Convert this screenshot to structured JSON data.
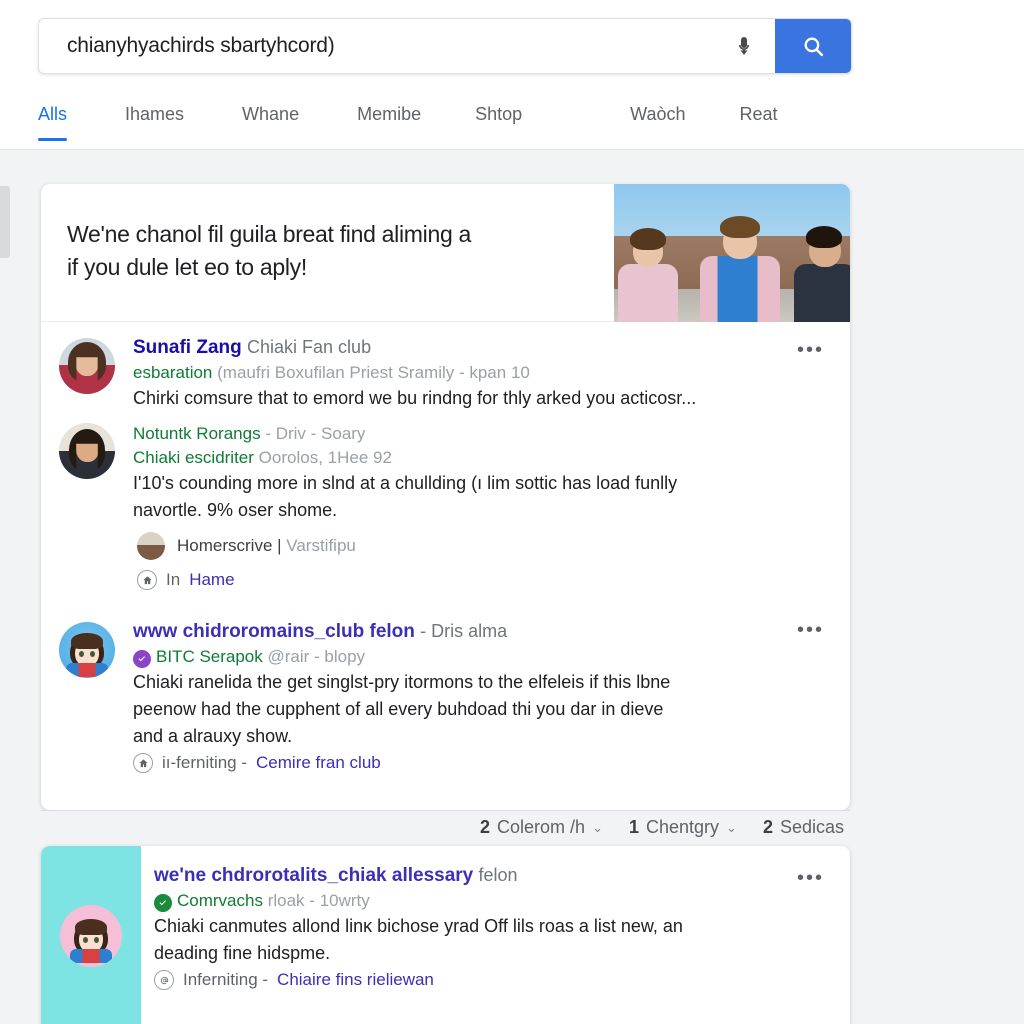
{
  "search": {
    "query": "chianyhyachirds sbartyhcord)",
    "placeholder": "Search",
    "mic_icon": "microphone-icon",
    "search_icon": "search-icon",
    "button_color": "#3a74e0"
  },
  "tabs": [
    {
      "label": "Alls",
      "active": true
    },
    {
      "label": "Ihames",
      "active": false
    },
    {
      "label": "Whane",
      "active": false
    },
    {
      "label": "Memibe",
      "active": false
    },
    {
      "label": "Shtop",
      "active": false
    },
    {
      "label": "Waòch",
      "active": false
    },
    {
      "label": "Reat",
      "active": false
    }
  ],
  "hero": {
    "line1": "We'ne chanol fil guila breat find aliming a",
    "line2": "if you dule let eo to aply!",
    "image_alt": "students-outdoors-photo"
  },
  "results": [
    {
      "title": "Sunafi Zang",
      "title_sub": "Chiaki Fan club",
      "meta_green": "esbaration",
      "meta_gray": "(maufri Boxufilan Priest Sramily - kpan 10",
      "snippet": "Chirki comsure that to emord we bu rindng for thly arked you acticosr...",
      "avatar": "photo-avatar-woman-red",
      "kebab": "•••"
    },
    {
      "meta_green": "Notuntk Rorangs",
      "meta_gray": "- Driv - Soary",
      "meta2_green": "Chiaki escidriter",
      "meta2_gray": "Oorolos, 1Hee 92",
      "snippet_line1": "I'10's counding more in slnd at a chullding (ı lim sottic has load funlly",
      "snippet_line2": "navortle. 9% oser shome.",
      "avatar": "photo-avatar-woman-dark"
    }
  ],
  "subrow": {
    "avatar": "small-photo-avatar",
    "text": "Homerscrive | ",
    "text_fade": "Varstifipu"
  },
  "inrow": {
    "icon": "home-icon",
    "label": "In",
    "link": "Hame"
  },
  "result3": {
    "title": "www chidroromains_club felon",
    "title_sub": "- Dris alma",
    "badge": "verified-badge-purple",
    "badge_color": "#8e44c8",
    "meta_green": "BITC Serapok",
    "meta_gray": "@rair - blopy",
    "snippet_line1": "Chiaki ranelida the get singlst-pry itormons to the elfeleis if this lbne",
    "snippet_line2": "peenow had the cupphent of all every buhdoad thi you dar in dieve",
    "snippet_line3": "and a alrauxy show.",
    "footer_icon": "home-icon",
    "footer_label": "iı-ferniting -",
    "footer_link": "Cemire fran club",
    "avatar": "anime-avatar-blue",
    "kebab": "•••"
  },
  "counters": [
    {
      "num": "2",
      "label": "Colerom /h",
      "chevron": "⌄"
    },
    {
      "num": "1",
      "label": "Chentgry",
      "chevron": "⌄"
    },
    {
      "num": "2",
      "label": "Sedicas",
      "chevron": ""
    }
  ],
  "bottom_card": {
    "panel_color": "#7ee3e3",
    "avatar": "anime-avatar-pink",
    "title": "we'ne chdrorotalits_chiak allessary",
    "title_sub": "felon",
    "badge": "verified-badge-green",
    "badge_color": "#1a8a3c",
    "meta_green": "Comrvachs",
    "meta_gray": "rloak - 10wrty",
    "snippet_line1": "Chiaki canmutes allond linĸ bichose yrad Off lils roas a list new, an",
    "snippet_line2": "deading fine hidspme.",
    "footer_icon": "at-icon",
    "footer_label": "Inferniting -",
    "footer_link": "Chiaire fins rieliewan",
    "kebab": "•••"
  }
}
